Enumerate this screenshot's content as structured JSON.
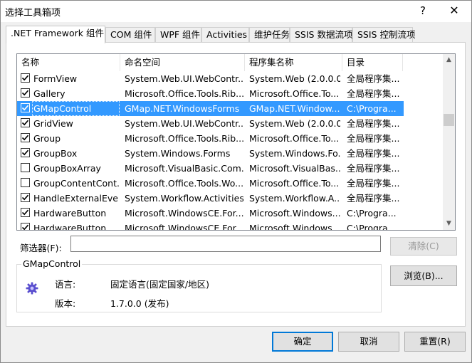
{
  "window": {
    "title": "选择工具箱项",
    "help_label": "?",
    "close_label": "✕"
  },
  "tabs": [
    {
      "label": ".NET Framework 组件",
      "active": true
    },
    {
      "label": "COM 组件"
    },
    {
      "label": "WPF 组件"
    },
    {
      "label": "Activities"
    },
    {
      "label": "维护任务"
    },
    {
      "label": "SSIS 数据流项"
    },
    {
      "label": "SSIS 控制流项"
    }
  ],
  "list": {
    "columns": [
      "名称",
      "命名空间",
      "程序集名称",
      "目录"
    ],
    "rows": [
      {
        "name": "FormView",
        "namespace": "System.Web.UI.WebContr...",
        "assembly": "System.Web (2.0.0.0)",
        "dir": "全局程序集...",
        "checked": true
      },
      {
        "name": "Gallery",
        "namespace": "Microsoft.Office.Tools.Rib...",
        "assembly": "Microsoft.Office.To...",
        "dir": "全局程序集...",
        "checked": true
      },
      {
        "name": "GMapControl",
        "namespace": "GMap.NET.WindowsForms",
        "assembly": "GMap.NET.Window...",
        "dir": "C:\\Progra...",
        "checked": true,
        "selected": true
      },
      {
        "name": "GridView",
        "namespace": "System.Web.UI.WebContr...",
        "assembly": "System.Web (2.0.0.0)",
        "dir": "全局程序集...",
        "checked": true
      },
      {
        "name": "Group",
        "namespace": "Microsoft.Office.Tools.Rib...",
        "assembly": "Microsoft.Office.To...",
        "dir": "全局程序集...",
        "checked": true
      },
      {
        "name": "GroupBox",
        "namespace": "System.Windows.Forms",
        "assembly": "System.Windows.Fo...",
        "dir": "全局程序集...",
        "checked": true
      },
      {
        "name": "GroupBoxArray",
        "namespace": "Microsoft.VisualBasic.Com...",
        "assembly": "Microsoft.VisualBas...",
        "dir": "全局程序集...",
        "checked": false
      },
      {
        "name": "GroupContentCont...",
        "namespace": "Microsoft.Office.Tools.Wo...",
        "assembly": "Microsoft.Office.To...",
        "dir": "全局程序集...",
        "checked": false
      },
      {
        "name": "HandleExternalEvent",
        "namespace": "System.Workflow.Activities",
        "assembly": "System.Workflow.A...",
        "dir": "全局程序集...",
        "checked": true
      },
      {
        "name": "HardwareButton",
        "namespace": "Microsoft.WindowsCE.For...",
        "assembly": "Microsoft.Windows...",
        "dir": "C:\\Progra...",
        "checked": true
      },
      {
        "name": "HardwareButton",
        "namespace": "Microsoft.WindowsCE.For...",
        "assembly": "Microsoft.Windows...",
        "dir": "C:\\Progra...",
        "checked": true
      }
    ]
  },
  "filter": {
    "label": "筛选器(F):",
    "value": "",
    "clear_label": "清除(C)"
  },
  "details": {
    "group_title": "GMapControl",
    "language_label": "语言:",
    "language_value": "固定语言(固定国家/地区)",
    "version_label": "版本:",
    "version_value": "1.7.0.0 (发布)",
    "icon": "gear-icon"
  },
  "buttons": {
    "browse": "浏览(B)...",
    "ok": "确定",
    "cancel": "取消",
    "reset": "重置(R)"
  },
  "colors": {
    "selection": "#3399ff",
    "default_button_border": "#0078d7"
  }
}
